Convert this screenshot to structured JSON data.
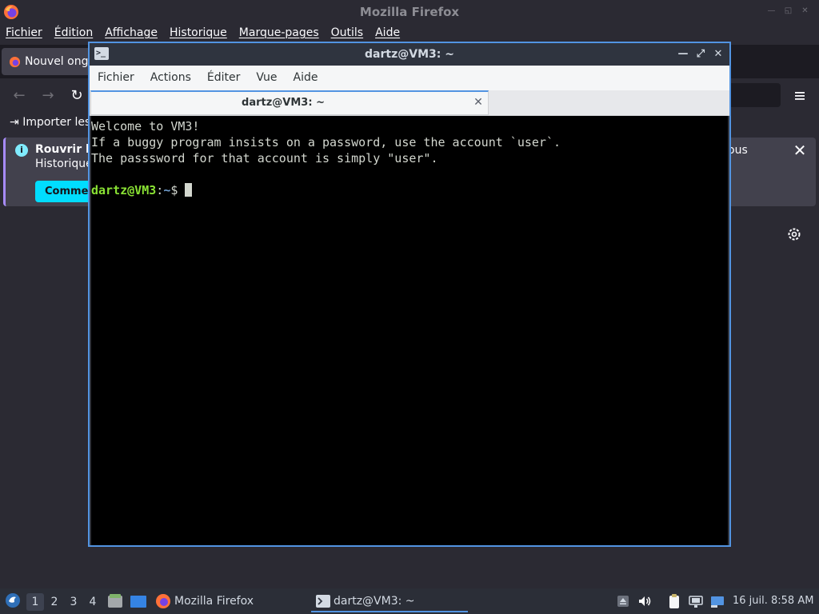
{
  "firefox": {
    "window_title": "Mozilla Firefox",
    "menus": [
      "Fichier",
      "Édition",
      "Affichage",
      "Historique",
      "Marque-pages",
      "Outils",
      "Aide"
    ],
    "tab_label": "Nouvel onglet",
    "import_label": "Importer les",
    "infobar": {
      "title": "Rouvrir le",
      "subtitle": "Historique",
      "button": "Commencer",
      "trailing_text": "ous"
    }
  },
  "terminal": {
    "window_title": "dartz@VM3: ~",
    "menus": [
      "Fichier",
      "Actions",
      "Éditer",
      "Vue",
      "Aide"
    ],
    "tab_label": "dartz@VM3: ~",
    "lines": [
      "Welcome to VM3!",
      "If a buggy program insists on a password, use the account `user`.",
      "The passsword for that account is simply \"user\"."
    ],
    "prompt": {
      "user_host": "dartz@VM3",
      "colon": ":",
      "dir": "~",
      "symbol": "$"
    }
  },
  "taskbar": {
    "workspaces": [
      "1",
      "2",
      "3",
      "4"
    ],
    "tasks": [
      {
        "label": "Mozilla Firefox",
        "icon": "firefox-icon"
      },
      {
        "label": "dartz@VM3: ~",
        "icon": "terminal-icon"
      }
    ],
    "clock": "16 juil. 8:58 AM"
  },
  "colors": {
    "accent": "#5294e2",
    "prompt_user": "#8ae234",
    "prompt_dir": "#729fcf",
    "infobar_button": "#00ddff"
  }
}
